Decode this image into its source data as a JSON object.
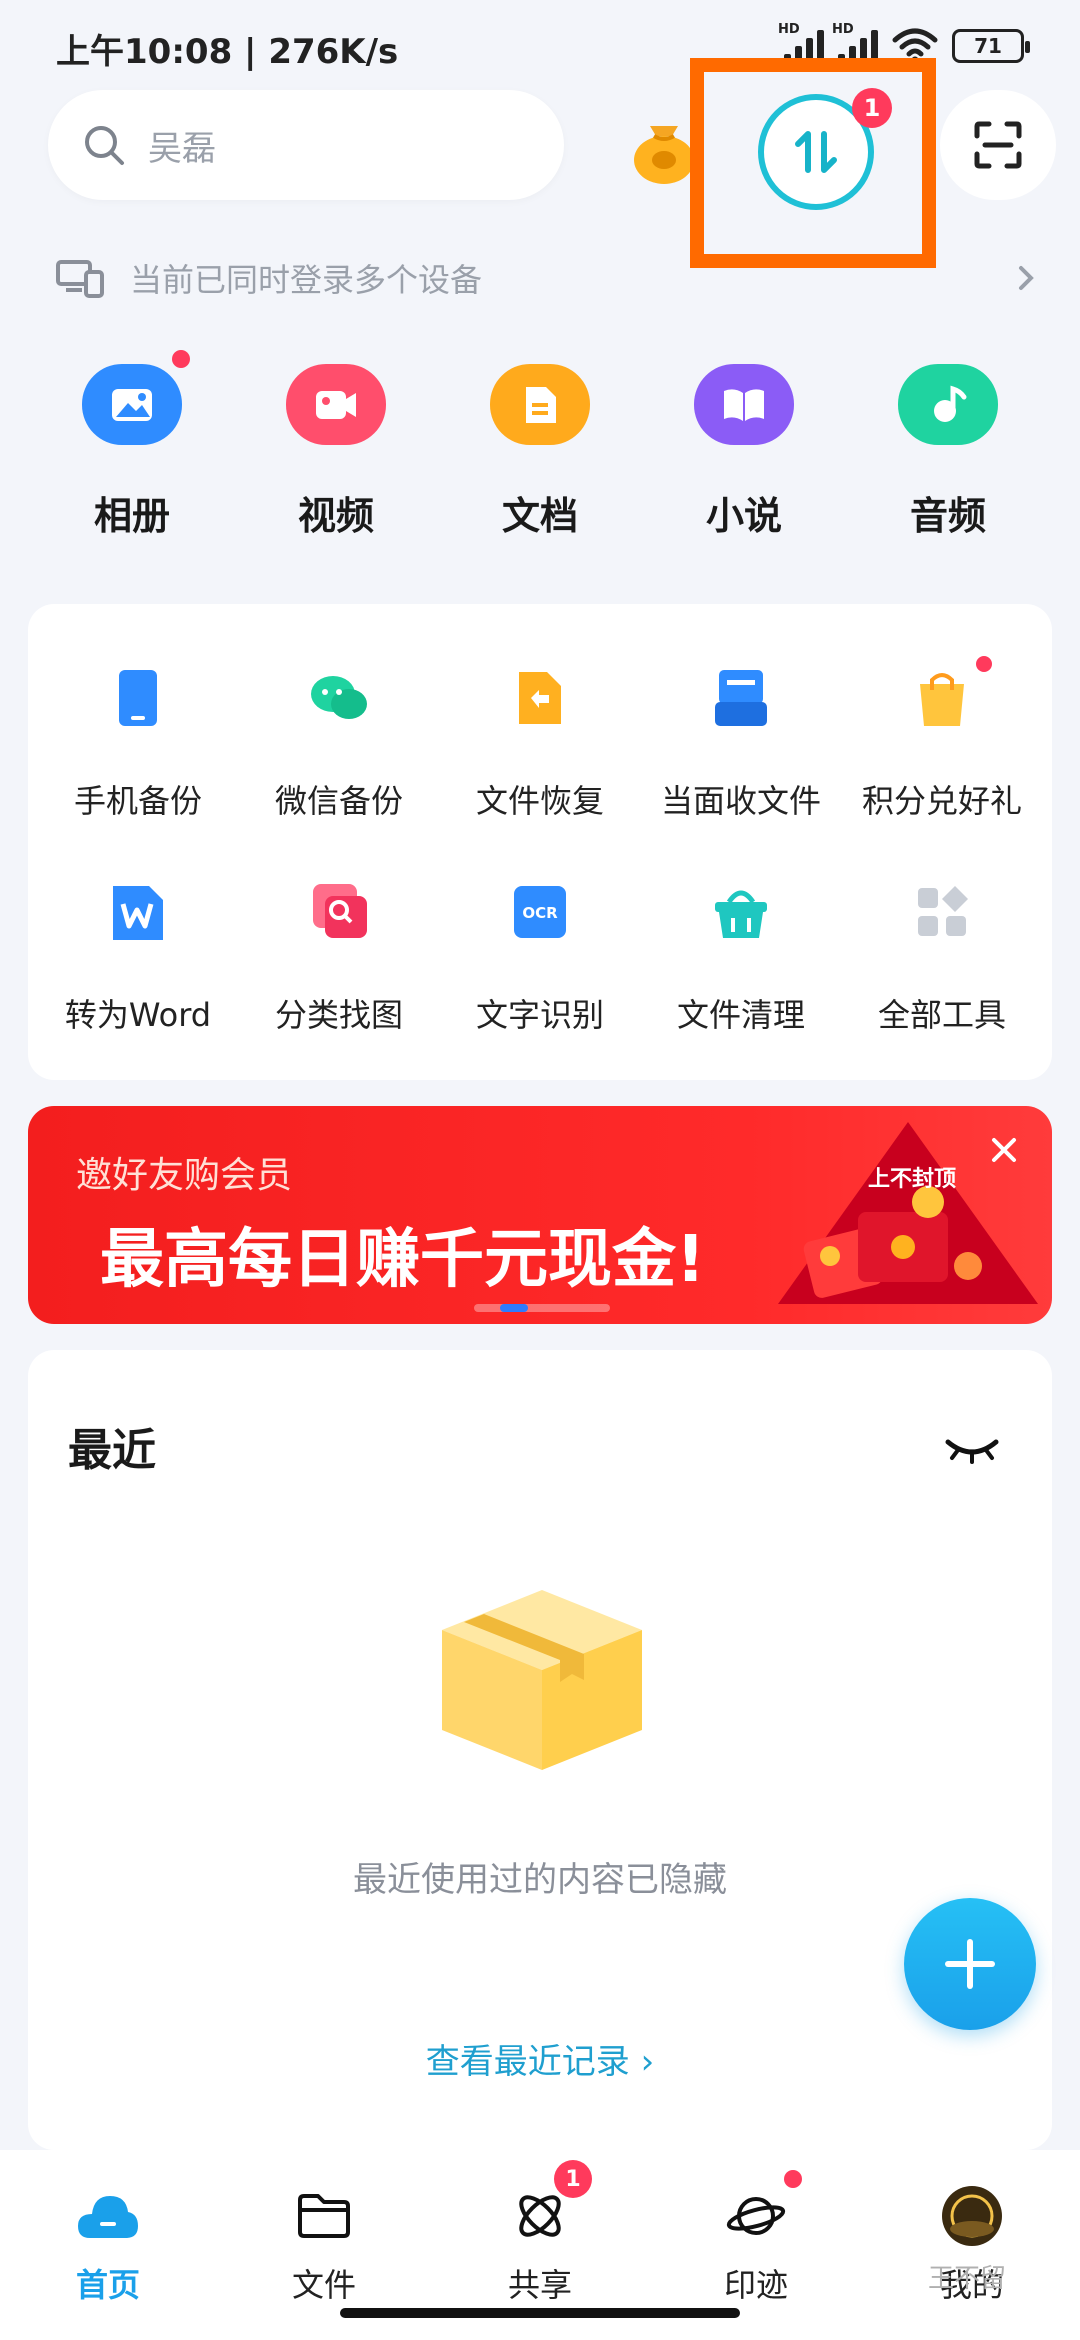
{
  "status_bar": {
    "time": "上午10:08 | 276K/s",
    "hd1": "HD",
    "hd2": "HD",
    "battery": "71"
  },
  "header": {
    "search_placeholder": "吴磊",
    "transfer_badge": "1"
  },
  "device_notice": "当前已同时登录多个设备",
  "categories": [
    {
      "label": "相册",
      "icon": "photo-icon",
      "color": "#2f8cff",
      "dot": true
    },
    {
      "label": "视频",
      "icon": "video-icon",
      "color": "#ff4e6c",
      "dot": false
    },
    {
      "label": "文档",
      "icon": "document-icon",
      "color": "#ffaa1c",
      "dot": false
    },
    {
      "label": "小说",
      "icon": "book-icon",
      "color": "#8b5cf6",
      "dot": false
    },
    {
      "label": "音频",
      "icon": "music-icon",
      "color": "#1fd3a0",
      "dot": false
    }
  ],
  "tools": [
    {
      "label": "手机备份",
      "icon": "phone-backup-icon",
      "color": "#2f8cff"
    },
    {
      "label": "微信备份",
      "icon": "wechat-backup-icon",
      "color": "#1fd3a0"
    },
    {
      "label": "文件恢复",
      "icon": "file-restore-icon",
      "color": "#ffb020"
    },
    {
      "label": "当面收文件",
      "icon": "receive-file-icon",
      "color": "#2f8cff"
    },
    {
      "label": "积分兑好礼",
      "icon": "gift-bag-icon",
      "color": "#ffc53d"
    },
    {
      "label": "转为Word",
      "icon": "word-convert-icon",
      "color": "#2f8cff"
    },
    {
      "label": "分类找图",
      "icon": "image-search-icon",
      "color": "#ff4e6c"
    },
    {
      "label": "文字识别",
      "icon": "ocr-icon",
      "color": "#2f8cff"
    },
    {
      "label": "文件清理",
      "icon": "clean-basket-icon",
      "color": "#1fc7c0"
    },
    {
      "label": "全部工具",
      "icon": "all-tools-icon",
      "color": "#c9ced6"
    }
  ],
  "tool_ocr_text": "OCR",
  "banner": {
    "subtitle": "邀好友购会员",
    "title": "最高每日赚千元现金!",
    "badge": "上不封顶"
  },
  "recent": {
    "title": "最近",
    "empty_text": "最近使用过的内容已隐藏",
    "link": "查看最近记录 ›"
  },
  "bottom_nav": [
    {
      "label": "首页",
      "icon": "cloud-home-icon",
      "active": true
    },
    {
      "label": "文件",
      "icon": "folder-icon",
      "active": false
    },
    {
      "label": "共享",
      "icon": "share-atom-icon",
      "active": false,
      "badge": "1"
    },
    {
      "label": "印迹",
      "icon": "planet-icon",
      "active": false,
      "dot": true
    },
    {
      "label": "我的",
      "icon": "avatar-icon",
      "active": false
    }
  ],
  "watermark": "王不留"
}
